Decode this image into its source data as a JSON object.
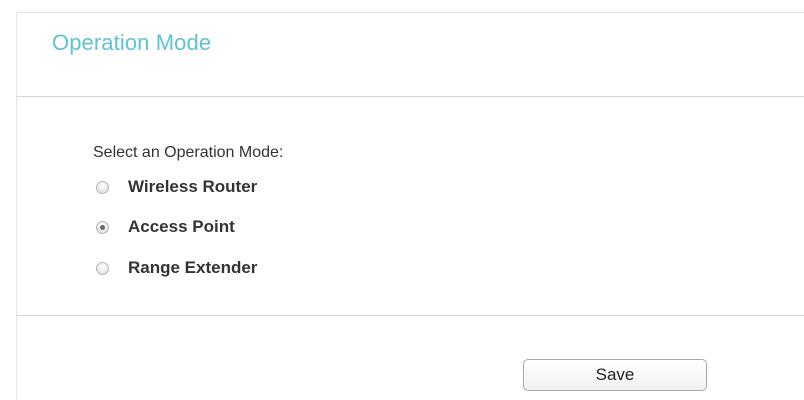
{
  "page": {
    "title": "Operation Mode",
    "accent_color": "#5ec3d4"
  },
  "form": {
    "label": "Select an Operation Mode:",
    "options": [
      {
        "label": "Wireless Router",
        "checked": false
      },
      {
        "label": "Access Point",
        "checked": true
      },
      {
        "label": "Range Extender",
        "checked": false
      }
    ]
  },
  "actions": {
    "save_label": "Save"
  }
}
